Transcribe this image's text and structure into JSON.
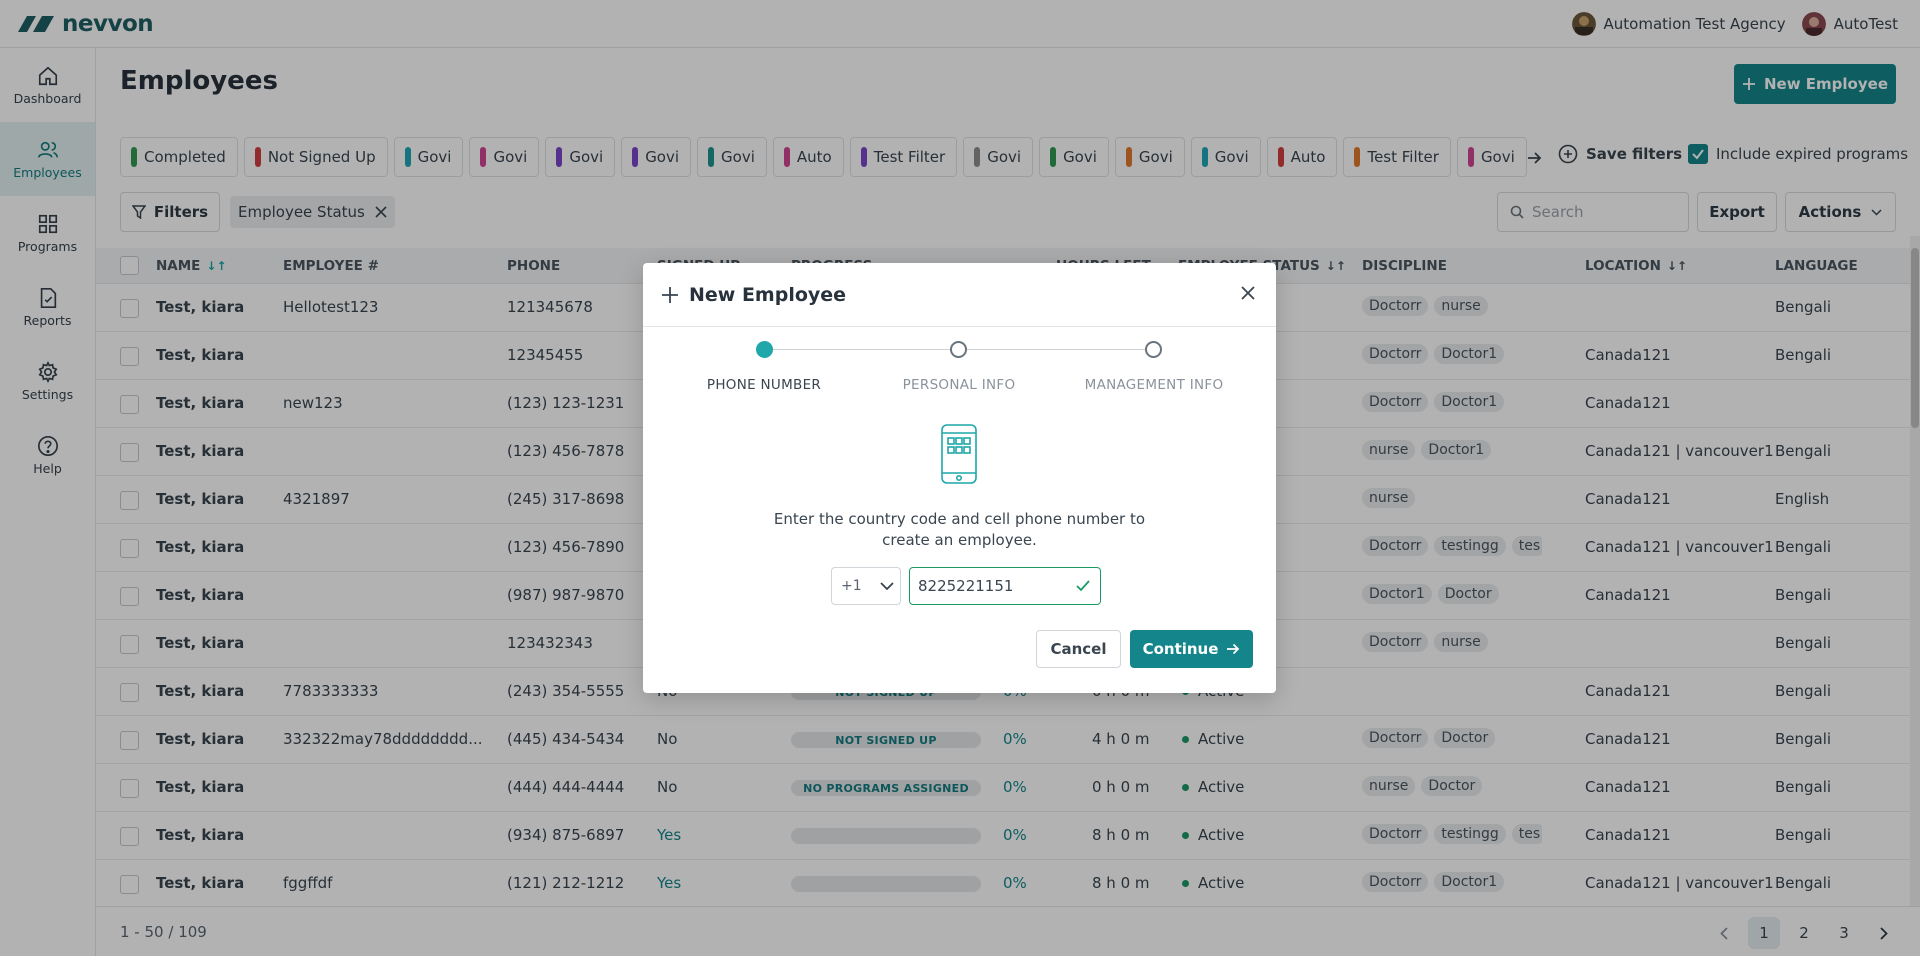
{
  "brand": {
    "name": "nevvon"
  },
  "topbar": {
    "agency": "Automation Test Agency",
    "user": "AutoTest"
  },
  "sidebar": {
    "items": [
      {
        "label": "Dashboard",
        "icon": "home-icon"
      },
      {
        "label": "Employees",
        "icon": "users-icon"
      },
      {
        "label": "Programs",
        "icon": "grid-icon"
      },
      {
        "label": "Reports",
        "icon": "report-icon"
      },
      {
        "label": "Settings",
        "icon": "gear-icon"
      },
      {
        "label": "Help",
        "icon": "help-icon"
      }
    ]
  },
  "page": {
    "title": "Employees",
    "new_button": "New Employee"
  },
  "filter_chips": [
    {
      "label": "Completed",
      "color": "#2e9a4f"
    },
    {
      "label": "Not Signed Up",
      "color": "#d2403f"
    },
    {
      "label": "Govi",
      "color": "#20a7b8"
    },
    {
      "label": "Govi",
      "color": "#d04494"
    },
    {
      "label": "Govi",
      "color": "#7a46c9"
    },
    {
      "label": "Govi",
      "color": "#7a46c9"
    },
    {
      "label": "Govi",
      "color": "#20938e"
    },
    {
      "label": "Auto",
      "color": "#d04494"
    },
    {
      "label": "Test Filter",
      "color": "#7a46c9"
    },
    {
      "label": "Govi",
      "color": "#8f8f8f"
    },
    {
      "label": "Govi",
      "color": "#2e9a4f"
    },
    {
      "label": "Govi",
      "color": "#e07a30"
    },
    {
      "label": "Govi",
      "color": "#20a7b8"
    },
    {
      "label": "Auto",
      "color": "#d2403f"
    },
    {
      "label": "Test Filter",
      "color": "#e07a30"
    },
    {
      "label": "Govi",
      "color": "#d04494"
    }
  ],
  "toolbar": {
    "save_filters": "Save filters",
    "include_expired": "Include expired programs",
    "filters": "Filters",
    "active_filter": "Employee Status",
    "search_placeholder": "Search",
    "export": "Export",
    "actions": "Actions"
  },
  "table": {
    "headers": {
      "name": "NAME",
      "employee_no": "EMPLOYEE #",
      "phone": "PHONE",
      "signed_up": "SIGNED UP",
      "progress": "PROGRESS",
      "hours_left": "HOURS LEFT",
      "status": "EMPLOYEE STATUS",
      "discipline": "DISCIPLINE",
      "location": "LOCATION",
      "language": "LANGUAGE"
    },
    "rows": [
      {
        "name": "Test, kiara",
        "emp": "Hellotest123",
        "phone": "121345678",
        "signed": "",
        "bar": "",
        "pct": "",
        "hours": "",
        "status": "",
        "tags": [
          "Doctorr",
          "nurse"
        ],
        "location": "",
        "language": "Bengali"
      },
      {
        "name": "Test, kiara",
        "emp": "",
        "phone": "12345455",
        "signed": "",
        "bar": "",
        "pct": "",
        "hours": "",
        "status": "",
        "tags": [
          "Doctorr",
          "Doctor1"
        ],
        "location": "Canada121",
        "language": "Bengali"
      },
      {
        "name": "Test, kiara",
        "emp": "new123",
        "phone": "(123) 123-1231",
        "signed": "",
        "bar": "",
        "pct": "",
        "hours": "",
        "status": "",
        "tags": [
          "Doctorr",
          "Doctor1"
        ],
        "location": "Canada121",
        "language": ""
      },
      {
        "name": "Test, kiara",
        "emp": "",
        "phone": "(123) 456-7878",
        "signed": "",
        "bar": "",
        "pct": "",
        "hours": "",
        "status": "",
        "tags": [
          "nurse",
          "Doctor1"
        ],
        "location": "Canada121 | vancouver1",
        "language": "Bengali"
      },
      {
        "name": "Test, kiara",
        "emp": "4321897",
        "phone": "(245) 317-8698",
        "signed": "",
        "bar": "",
        "pct": "",
        "hours": "",
        "status": "",
        "tags": [
          "nurse"
        ],
        "location": "Canada121",
        "language": "English"
      },
      {
        "name": "Test, kiara",
        "emp": "",
        "phone": "(123) 456-7890",
        "signed": "",
        "bar": "",
        "pct": "",
        "hours": "",
        "status": "",
        "tags": [
          "Doctorr",
          "testingg",
          "tes"
        ],
        "location": "Canada121 | vancouver1",
        "language": "Bengali"
      },
      {
        "name": "Test, kiara",
        "emp": "",
        "phone": "(987) 987-9870",
        "signed": "",
        "bar": "",
        "pct": "",
        "hours": "",
        "status": "",
        "tags": [
          "Doctor1",
          "Doctor"
        ],
        "location": "Canada121",
        "language": "Bengali"
      },
      {
        "name": "Test, kiara",
        "emp": "",
        "phone": "123432343",
        "signed": "",
        "bar": "",
        "pct": "",
        "hours": "",
        "status": "",
        "tags": [
          "Doctorr",
          "nurse"
        ],
        "location": "",
        "language": "Bengali"
      },
      {
        "name": "Test, kiara",
        "emp": "7783333333",
        "phone": "(243) 354-5555",
        "signed": "No",
        "bar": "NOT SIGNED UP",
        "pct": "0%",
        "hours": "0 h 0 m",
        "status": "Active",
        "tags": [],
        "location": "Canada121",
        "language": "Bengali"
      },
      {
        "name": "Test, kiara",
        "emp": "332322may78dddddddd...",
        "phone": "(445) 434-5434",
        "signed": "No",
        "bar": "NOT SIGNED UP",
        "pct": "0%",
        "hours": "4 h 0 m",
        "status": "Active",
        "tags": [
          "Doctorr",
          "Doctor"
        ],
        "location": "Canada121",
        "language": "Bengali"
      },
      {
        "name": "Test, kiara",
        "emp": "",
        "phone": "(444) 444-4444",
        "signed": "No",
        "bar": "NO PROGRAMS ASSIGNED",
        "pct": "0%",
        "hours": "0 h 0 m",
        "status": "Active",
        "tags": [
          "nurse",
          "Doctor"
        ],
        "location": "Canada121",
        "language": "Bengali"
      },
      {
        "name": "Test, kiara",
        "emp": "",
        "phone": "(934) 875-6897",
        "signed": "Yes",
        "bar": "",
        "pct": "0%",
        "hours": "8 h 0 m",
        "status": "Active",
        "tags": [
          "Doctorr",
          "testingg",
          "tes"
        ],
        "location": "Canada121",
        "language": "Bengali"
      },
      {
        "name": "Test, kiara",
        "emp": "fggffdf",
        "phone": "(121) 212-1212",
        "signed": "Yes",
        "bar": "",
        "pct": "0%",
        "hours": "8 h 0 m",
        "status": "Active",
        "tags": [
          "Doctorr",
          "Doctor1"
        ],
        "location": "Canada121 | vancouver1",
        "language": "Bengali"
      }
    ]
  },
  "pagination": {
    "range": "1 - 50",
    "sep": "/",
    "total": "109",
    "pages": [
      "1",
      "2",
      "3"
    ],
    "current": "1"
  },
  "modal": {
    "title": "New Employee",
    "steps": [
      "PHONE NUMBER",
      "PERSONAL INFO",
      "MANAGEMENT INFO"
    ],
    "active_step": 0,
    "instruction_line1": "Enter the country code and cell phone number to",
    "instruction_line2": "create an employee.",
    "country_code": "+1",
    "phone_value": "8225221151",
    "cancel": "Cancel",
    "continue": "Continue"
  },
  "colors": {
    "accent": "#14868b",
    "active_dot": "#1fa7a9",
    "valid": "#1a9a62"
  }
}
